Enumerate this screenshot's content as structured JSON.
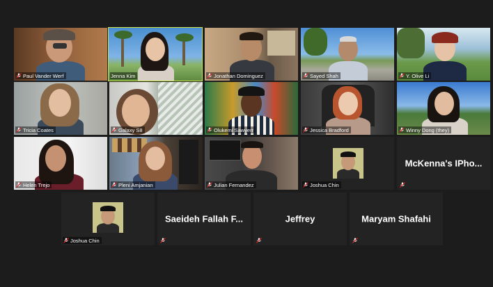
{
  "tiles": [
    {
      "name": "Paul Vander Werf"
    },
    {
      "name": "Jenna Kim"
    },
    {
      "name": "Jonathan Dominguez"
    },
    {
      "name": "Sayed Shah"
    },
    {
      "name": "Y. Olive Li"
    },
    {
      "name": "Tricia Coates"
    },
    {
      "name": "Galaxy S8"
    },
    {
      "name": "Olukemi Sawyerr"
    },
    {
      "name": "Jessica Bradford"
    },
    {
      "name": "Winny Dong (they)"
    },
    {
      "name": "Helen Trejo"
    },
    {
      "name": "Pleni Amjanian"
    },
    {
      "name": "Julian Fernandez"
    },
    {
      "name": "Joshua Chin"
    },
    {
      "name": "McKenna's  IPho..."
    },
    {
      "name": "Joshua Chin"
    },
    {
      "name": "Saeideh  Fallah  F..."
    },
    {
      "name": "Jeffrey"
    },
    {
      "name": "Maryam Shafahi"
    }
  ],
  "icons": {
    "muted": "muted-mic-icon"
  },
  "colors": {
    "active_speaker": "#c8e64a",
    "muted": "#e02828",
    "background": "#1c1c1c",
    "tile": "#232323"
  }
}
